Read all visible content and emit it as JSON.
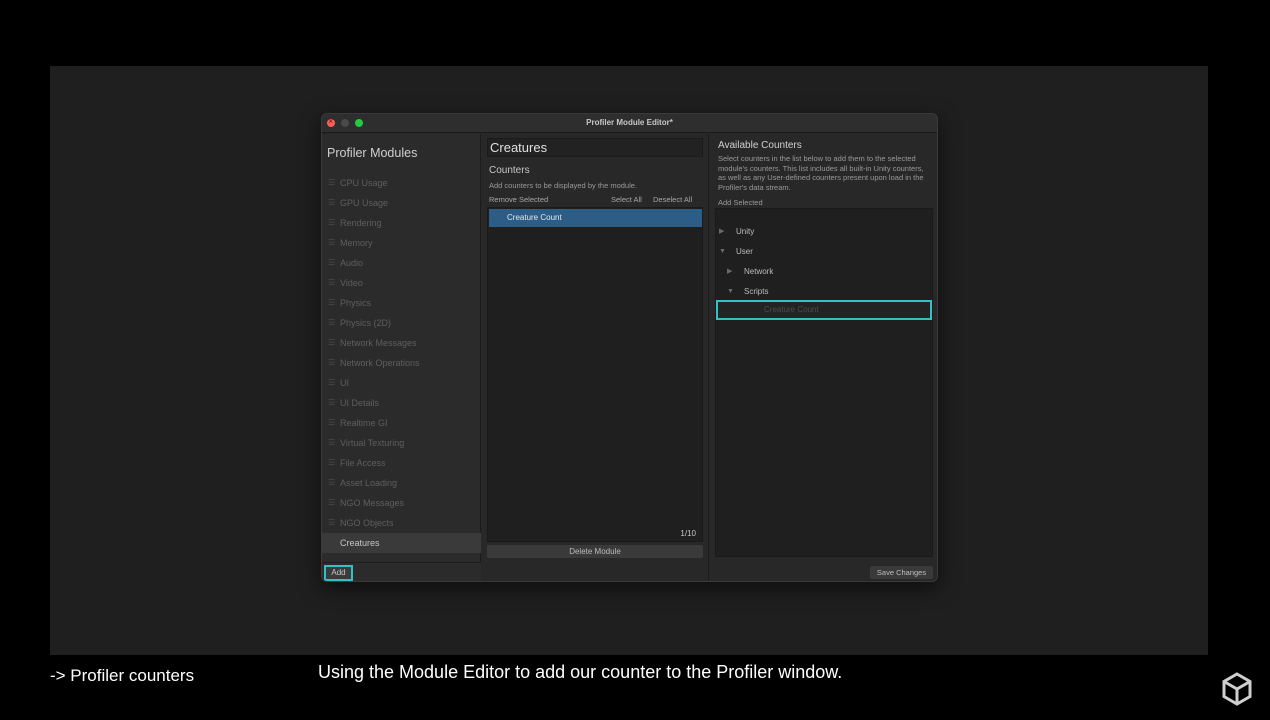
{
  "window": {
    "title": "Profiler Module Editor*"
  },
  "modules": {
    "heading": "Profiler Modules",
    "items": [
      {
        "label": "CPU Usage"
      },
      {
        "label": "GPU Usage"
      },
      {
        "label": "Rendering"
      },
      {
        "label": "Memory"
      },
      {
        "label": "Audio"
      },
      {
        "label": "Video"
      },
      {
        "label": "Physics"
      },
      {
        "label": "Physics (2D)"
      },
      {
        "label": "Network Messages"
      },
      {
        "label": "Network Operations"
      },
      {
        "label": "UI"
      },
      {
        "label": "UI Details"
      },
      {
        "label": "Realtime GI"
      },
      {
        "label": "Virtual Texturing"
      },
      {
        "label": "File Access"
      },
      {
        "label": "Asset Loading"
      },
      {
        "label": "NGO Messages"
      },
      {
        "label": "NGO Objects"
      },
      {
        "label": "Creatures",
        "selected": true
      }
    ],
    "add_label": "Add"
  },
  "module_detail": {
    "name": "Creatures",
    "counters_heading": "Counters",
    "counters_desc": "Add counters to be displayed by the module.",
    "remove_selected": "Remove Selected",
    "select_all": "Select All",
    "deselect_all": "Deselect All",
    "counters": [
      {
        "label": "Creature Count"
      }
    ],
    "count": "1/10",
    "delete_label": "Delete Module"
  },
  "available": {
    "heading": "Available Counters",
    "desc": "Select counters in the list below to add them to the selected module's counters. This list includes all built-in Unity counters, as well as any User-defined counters present upon load in the Profiler's data stream.",
    "add_selected": "Add Selected",
    "tree": [
      {
        "label": "Unity",
        "depth": 0,
        "arrow": "▶"
      },
      {
        "label": "User",
        "depth": 0,
        "arrow": "▼"
      },
      {
        "label": "Network",
        "depth": 1,
        "arrow": "▶"
      },
      {
        "label": "Scripts",
        "depth": 1,
        "arrow": "▼"
      },
      {
        "label": "Creature Count",
        "depth": 2,
        "arrow": "",
        "highlight": true
      }
    ],
    "save_label": "Save Changes"
  },
  "captions": {
    "section": "-> Profiler counters",
    "main": "Using the Module Editor to add our counter to the Profiler window."
  },
  "colors": {
    "accent": "#2ec4c4",
    "selection": "#2c5d87"
  },
  "icons": {
    "brand": "unity-logo-icon"
  }
}
